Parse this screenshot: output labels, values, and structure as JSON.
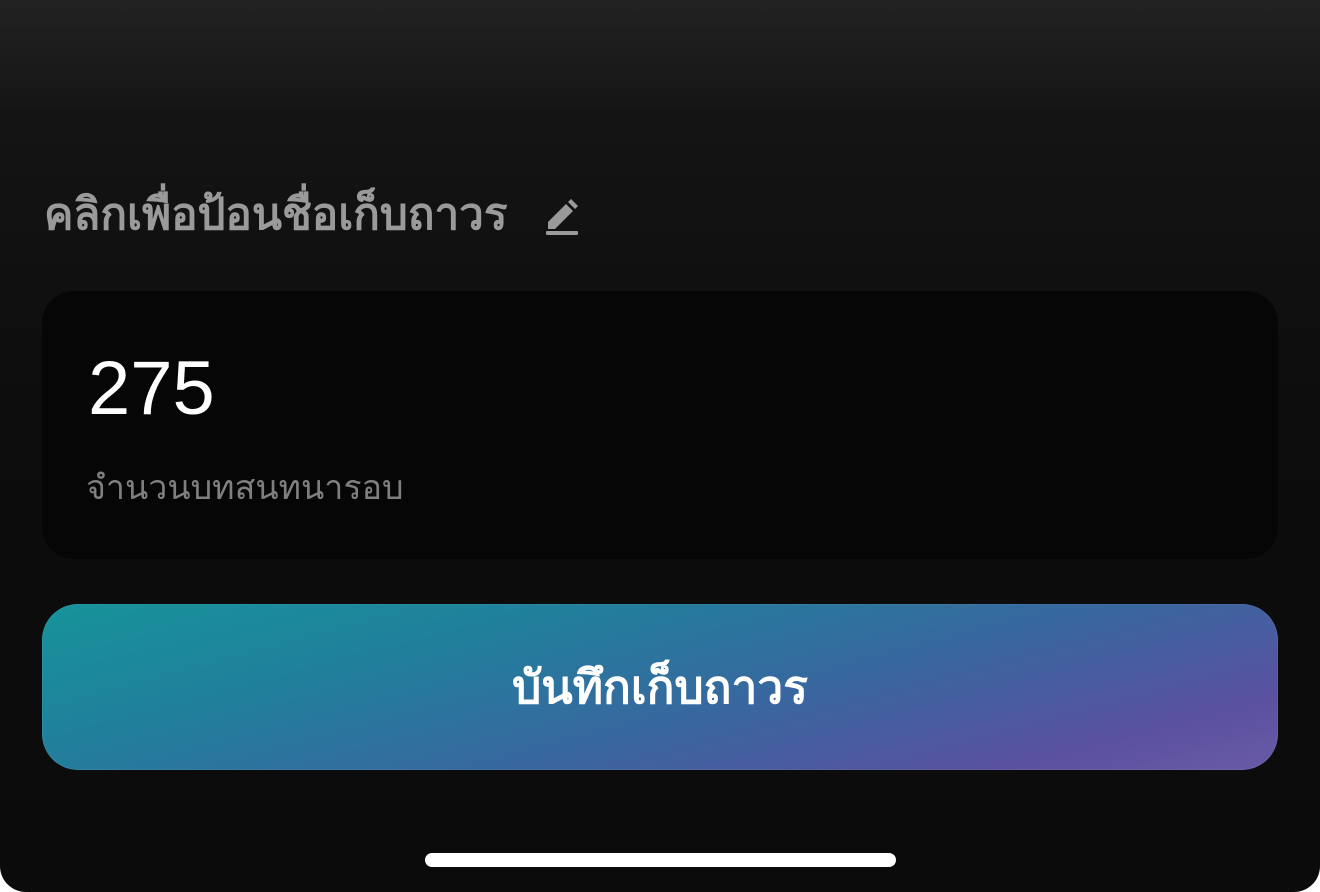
{
  "profile": {
    "name_placeholder": "คลิกเพื่อป้อนชื่อเก็บถาวร",
    "edit_icon": "pencil-icon"
  },
  "stats_card": {
    "value": "275",
    "label": "จำนวนบทสนทนารอบ"
  },
  "actions": {
    "save_label": "บันทึกเก็บถาวร"
  },
  "colors": {
    "background": "#0b0b0b",
    "card": "#060606",
    "muted_text": "#9a9a9a",
    "button_gradient_start": "#16939a",
    "button_gradient_end": "#6a5aa6"
  }
}
